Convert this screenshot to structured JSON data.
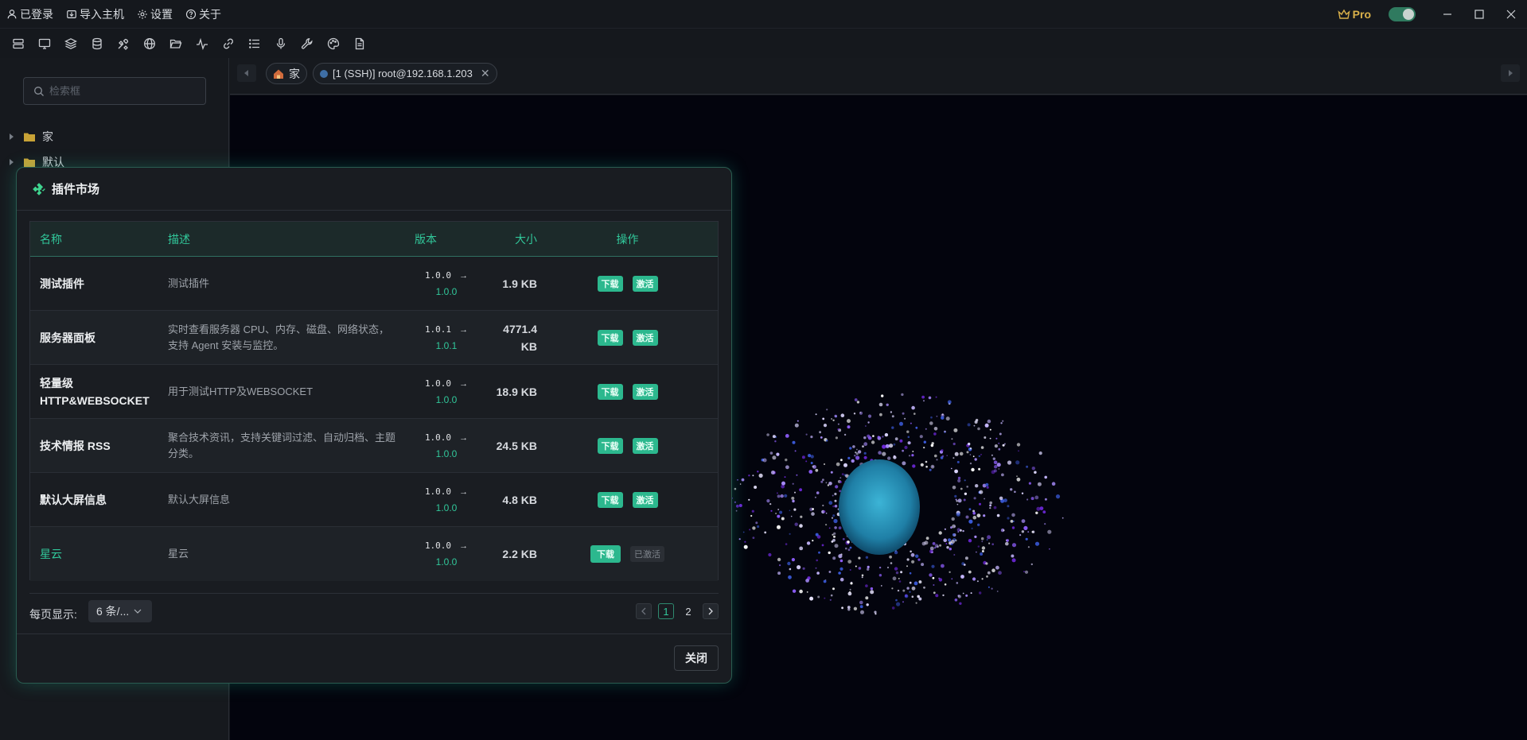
{
  "titlebar": {
    "menus": [
      {
        "icon": "user-icon",
        "label": "已登录"
      },
      {
        "icon": "import-icon",
        "label": "导入主机"
      },
      {
        "icon": "gear-icon",
        "label": "设置"
      },
      {
        "icon": "help-icon",
        "label": "关于"
      }
    ],
    "pro_label": "Pro",
    "toggle_on": true
  },
  "toolbar": {
    "icons": [
      "server-list-icon",
      "monitor-icon",
      "layers-icon",
      "database-icon",
      "tools-icon",
      "globe-icon",
      "folder-open-icon",
      "activity-icon",
      "link-icon",
      "list-icon",
      "microphone-icon",
      "wrench-icon",
      "palette-icon",
      "document-icon"
    ]
  },
  "sidebar": {
    "search_placeholder": "检索框",
    "tree": [
      {
        "label": "家"
      },
      {
        "label": "默认"
      }
    ]
  },
  "tabs": {
    "home_label": "家",
    "ssh_label": "[1 (SSH)] root@192.168.1.203"
  },
  "modal": {
    "title": "插件市场",
    "columns": {
      "name": "名称",
      "desc": "描述",
      "version": "版本",
      "size": "大小",
      "action": "操作"
    },
    "rows": [
      {
        "name": "测试插件",
        "desc": "测试插件",
        "ver_old": "1.0.0",
        "ver_new": "1.0.0",
        "size": "1.9 KB",
        "dl": "下载",
        "act": "激活",
        "activated": false
      },
      {
        "name": "服务器面板",
        "desc": "实时查看服务器 CPU、内存、磁盘、网络状态，支持 Agent 安装与监控。",
        "ver_old": "1.0.1",
        "ver_new": "1.0.1",
        "size": "4771.4 KB",
        "dl": "下载",
        "act": "激活",
        "activated": false
      },
      {
        "name": "轻量级 HTTP&WEBSOCKET",
        "desc": "用于测试HTTP及WEBSOCKET",
        "ver_old": "1.0.0",
        "ver_new": "1.0.0",
        "size": "18.9 KB",
        "dl": "下载",
        "act": "激活",
        "activated": false
      },
      {
        "name": "技术情报 RSS",
        "desc": "聚合技术资讯，支持关键词过滤、自动归档、主题分类。",
        "ver_old": "1.0.0",
        "ver_new": "1.0.0",
        "size": "24.5 KB",
        "dl": "下载",
        "act": "激活",
        "activated": false
      },
      {
        "name": "默认大屏信息",
        "desc": "默认大屏信息",
        "ver_old": "1.0.0",
        "ver_new": "1.0.0",
        "size": "4.8 KB",
        "dl": "下载",
        "act": "激活",
        "activated": false
      },
      {
        "name": "星云",
        "desc": "星云",
        "ver_old": "1.0.0",
        "ver_new": "1.0.0",
        "size": "2.2 KB",
        "dl": "下载",
        "act": "已激活",
        "activated": true
      }
    ],
    "page_size_label": "每页显示:",
    "page_size_value": "6 条/...",
    "pages": [
      "1",
      "2"
    ],
    "current_page": "1",
    "close_label": "关闭"
  },
  "colors": {
    "accent": "#2cb88e",
    "accent_text": "#31c79a",
    "pro": "#d9b04a",
    "terminal_bg": "#03040d"
  }
}
